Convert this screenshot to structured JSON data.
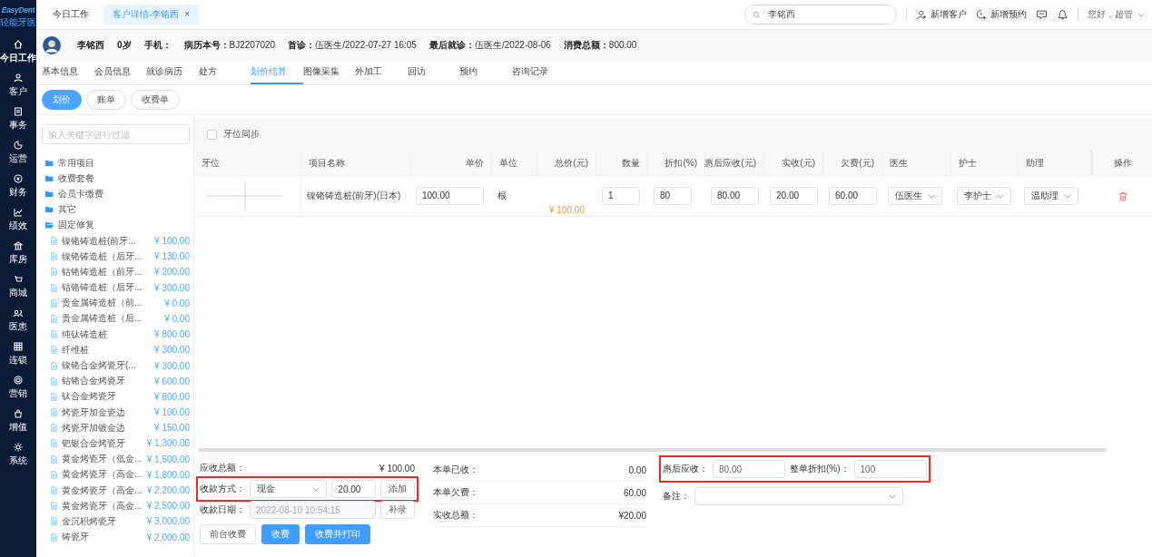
{
  "brand": {
    "name": "EasyDent",
    "subtitle": "轻能牙医"
  },
  "sidebar": {
    "items": [
      {
        "kind": "home",
        "label": "今日工作",
        "selected": true
      },
      {
        "kind": "user",
        "label": "客户",
        "selected": false
      },
      {
        "kind": "doc",
        "label": "事务",
        "selected": false
      },
      {
        "kind": "pie",
        "label": "运营",
        "selected": false
      },
      {
        "kind": "coin",
        "label": "财务",
        "selected": false
      },
      {
        "kind": "chart",
        "label": "绩效",
        "selected": false
      },
      {
        "kind": "bank",
        "label": "库房",
        "selected": false
      },
      {
        "kind": "cart",
        "label": "商城",
        "selected": false
      },
      {
        "kind": "people",
        "label": "医患",
        "selected": false
      },
      {
        "kind": "grid",
        "label": "连锁",
        "selected": false
      },
      {
        "kind": "target",
        "label": "营销",
        "selected": false
      },
      {
        "kind": "bag",
        "label": "增值",
        "selected": false
      },
      {
        "kind": "gear",
        "label": "系统",
        "selected": false
      }
    ]
  },
  "top_tabs": [
    {
      "label": "今日工作",
      "selected": false
    },
    {
      "label": "客户详情-李铭西",
      "selected": true,
      "close": "×"
    }
  ],
  "search": {
    "value": "李铭西"
  },
  "header_actions": [
    {
      "kind": "add-user",
      "label": "新增客户"
    },
    {
      "kind": "add-clock",
      "label": "新增预约"
    },
    {
      "kind": "message"
    },
    {
      "kind": "bell"
    }
  ],
  "user": {
    "greeting": "您好，超管"
  },
  "patient": {
    "name": "李铭西",
    "age": "0岁",
    "fields": [
      {
        "label": "手机："
      },
      {
        "label": "病历本号：",
        "value": "BJ2207020"
      },
      {
        "label": "首诊：",
        "value": "伍医生/2022-07-27 16:05"
      },
      {
        "label": "最后就诊：",
        "value": "伍医生/2022-08-06"
      },
      {
        "label": "消费总额：",
        "value": "800.00"
      }
    ]
  },
  "detail_tabs": [
    {
      "label": "基本信息",
      "selected": false
    },
    {
      "label": "会员信息",
      "selected": false
    },
    {
      "label": "就诊病历",
      "selected": false
    },
    {
      "label": "处方",
      "selected": false
    },
    {
      "label": "划价结算",
      "selected": true
    },
    {
      "label": "图像采集",
      "selected": false
    },
    {
      "label": "外加工",
      "selected": false
    },
    {
      "label": "回访",
      "selected": false
    },
    {
      "label": "预约",
      "selected": false
    },
    {
      "label": "咨询记录",
      "selected": false
    }
  ],
  "sub_tabs": [
    {
      "label": "划价",
      "selected": true
    },
    {
      "label": "账单",
      "selected": false
    },
    {
      "label": "收费单",
      "selected": false
    }
  ],
  "filter": {
    "placeholder": "输入关键字进行过滤"
  },
  "tree": [
    {
      "label": "常用项目",
      "expanded": false
    },
    {
      "label": "收费套餐",
      "expanded": false
    },
    {
      "label": "会员卡缴费",
      "expanded": false
    },
    {
      "label": "其它",
      "expanded": false
    },
    {
      "label": "固定修复",
      "expanded": true,
      "children": [
        {
          "label": "镍铬铸造桩(前牙...",
          "price": "¥ 100.00"
        },
        {
          "label": "镍铬铸造桩（后牙...",
          "price": "¥ 130.00"
        },
        {
          "label": "钴铬铸造桩（前牙...",
          "price": "¥ 200.00"
        },
        {
          "label": "钴铬铸造桩（后牙...",
          "price": "¥ 300.00"
        },
        {
          "label": "贵金属铸造桩（前...",
          "price": "¥ 0.00"
        },
        {
          "label": "贵金属铸造桩（后...",
          "price": "¥ 0.00"
        },
        {
          "label": "纯钛铸造桩",
          "price": "¥ 800.00"
        },
        {
          "label": "纤维桩",
          "price": "¥ 300.00"
        },
        {
          "label": "镍铬合金烤瓷牙(...",
          "price": "¥ 300.00"
        },
        {
          "label": "钴铬合金烤瓷牙",
          "price": "¥ 600.00"
        },
        {
          "label": "钛合金烤瓷牙",
          "price": "¥ 800.00"
        },
        {
          "label": "烤瓷牙加金瓷边",
          "price": "¥ 100.00"
        },
        {
          "label": "烤瓷牙加镀金边",
          "price": "¥ 150.00"
        },
        {
          "label": "钯银合金烤瓷牙",
          "price": "¥ 1,300.00"
        },
        {
          "label": "黄金烤瓷牙（低金...",
          "price": "¥ 1,500.00"
        },
        {
          "label": "黄金烤瓷牙（高金...",
          "price": "¥ 1,800.00"
        },
        {
          "label": "黄金烤瓷牙（高金...",
          "price": "¥ 2,200.00"
        },
        {
          "label": "黄金烤瓷牙（高金...",
          "price": "¥ 2,500.00"
        },
        {
          "label": "金沉积烤瓷牙",
          "price": "¥ 3,000.00"
        },
        {
          "label": "铸瓷牙",
          "price": "¥ 2,000.00"
        }
      ]
    }
  ],
  "sync": {
    "label": "牙位同步",
    "checked": false
  },
  "table": {
    "columns": [
      "牙位",
      "项目名称",
      "单价",
      "单位",
      "总价(元)",
      "数量",
      "折扣(%)",
      "惠后应收(元)",
      "实收(元)",
      "欠费(元)",
      "医生",
      "护士",
      "助理",
      "操作"
    ],
    "rows": [
      {
        "name": "镍铬铸造桩(前牙)(日本)",
        "unit_price": "100.00",
        "unit": "根",
        "total": "¥ 100.00",
        "quantity": "1",
        "discount": "80",
        "after_discount": "80.00",
        "paid": "20.00",
        "owed": "60.00",
        "doctor": "伍医生",
        "nurse": "李护士",
        "assistant": "温助理"
      }
    ]
  },
  "summary": {
    "receivable": {
      "label": "应收总额：",
      "value": "¥ 100.00"
    },
    "payment": {
      "label": "收款方式：",
      "method": "现金",
      "amount": "20.00",
      "add": "添加",
      "highlighted": true
    },
    "date": {
      "label": "收款日期：",
      "value": "2022-08-10 10:54:15",
      "button": "补录"
    },
    "buttons": [
      {
        "label": "前台收费",
        "primary": false
      },
      {
        "label": "收费",
        "primary": true
      },
      {
        "label": "收费并打印",
        "primary": true
      }
    ],
    "stats": [
      {
        "label": "本单已收：",
        "value": "0.00"
      },
      {
        "label": "本单欠费：",
        "value": "60.00"
      },
      {
        "label": "实收总额：",
        "value": "¥20.00"
      }
    ],
    "discount": {
      "after_label": "惠后应收：",
      "after_value": "80.00",
      "whole_label": "整单折扣(%)：",
      "whole_value": "100",
      "highlighted": true
    },
    "remark": {
      "label": "备注："
    }
  }
}
